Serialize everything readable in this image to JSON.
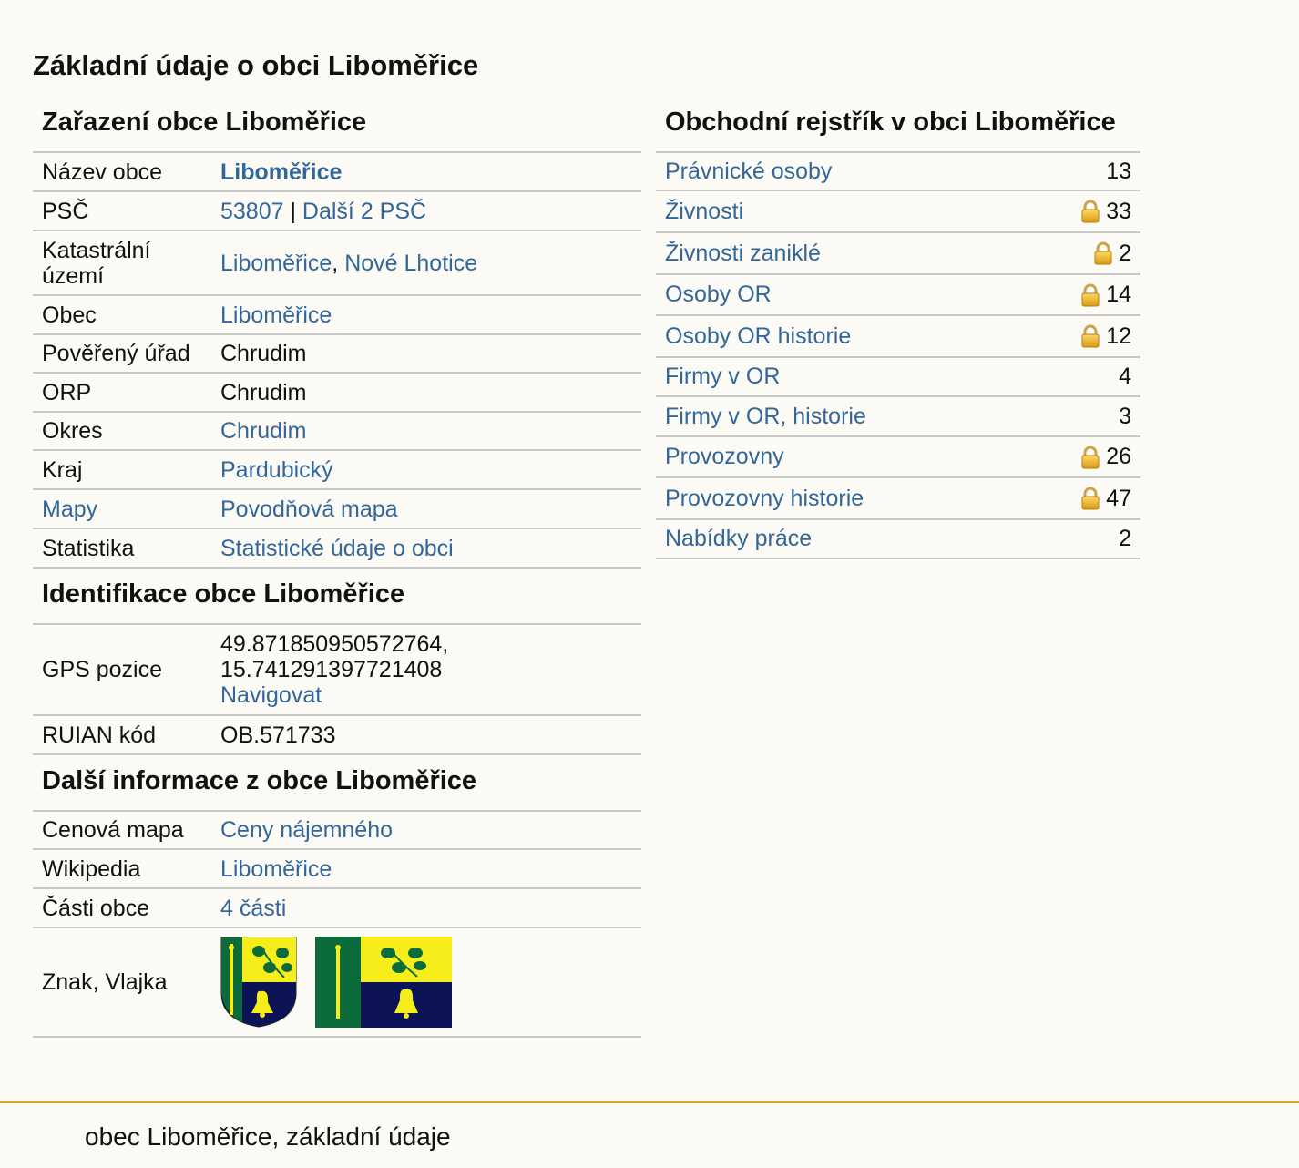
{
  "page_title": "Základní údaje o obci Liboměřice",
  "zarazeni": {
    "title": "Zařazení obce Liboměřice",
    "nazev_label": "Název obce",
    "nazev_value": "Liboměřice",
    "psc_label": "PSČ",
    "psc_value": "53807",
    "psc_sep": " | ",
    "psc_more": "Další 2 PSČ",
    "kat_label": "Katastrální území",
    "kat_value1": "Liboměřice",
    "kat_sep": ", ",
    "kat_value2": "Nové Lhotice",
    "obec_label": "Obec",
    "obec_value": "Liboměřice",
    "povereny_label": "Pověřený úřad",
    "povereny_value": "Chrudim",
    "orp_label": "ORP",
    "orp_value": "Chrudim",
    "okres_label": "Okres",
    "okres_value": "Chrudim",
    "kraj_label": "Kraj",
    "kraj_value": "Pardubický",
    "mapy_label": "Mapy",
    "mapy_value": "Povodňová mapa",
    "statistika_label": "Statistika",
    "statistika_value": "Statistické údaje o obci"
  },
  "identifikace": {
    "title": "Identifikace obce Liboměřice",
    "gps_label": "GPS pozice",
    "gps_lat": "49.871850950572764,",
    "gps_lon": "15.741291397721408",
    "gps_nav": "Navigovat",
    "ruian_label": "RUIAN kód",
    "ruian_value": "OB.571733"
  },
  "dalsi": {
    "title": "Další informace z obce Liboměřice",
    "cenova_label": "Cenová mapa",
    "cenova_value": "Ceny nájemného",
    "wiki_label": "Wikipedia",
    "wiki_value": "Liboměřice",
    "casti_label": "Části obce",
    "casti_value": "4 části",
    "znak_label": "Znak, Vlajka"
  },
  "rejstrik": {
    "title": "Obchodní rejstřík v obci Liboměřice",
    "items": [
      {
        "label": "Právnické osoby",
        "count": "13",
        "locked": false
      },
      {
        "label": "Živnosti",
        "count": "33",
        "locked": true
      },
      {
        "label": "Živnosti zaniklé",
        "count": "2",
        "locked": true
      },
      {
        "label": "Osoby OR",
        "count": "14",
        "locked": true
      },
      {
        "label": "Osoby OR historie",
        "count": "12",
        "locked": true
      },
      {
        "label": "Firmy v OR",
        "count": "4",
        "locked": false
      },
      {
        "label": "Firmy v OR, historie",
        "count": "3",
        "locked": false
      },
      {
        "label": "Provozovny",
        "count": "26",
        "locked": true
      },
      {
        "label": "Provozovny historie",
        "count": "47",
        "locked": true
      },
      {
        "label": "Nabídky práce",
        "count": "2",
        "locked": false
      }
    ]
  },
  "footer": {
    "text": "obec Liboměřice, základní údaje"
  },
  "colors": {
    "link": "#336699",
    "background": "#fbfaf5",
    "footer_line": "#d6a82e",
    "emblem_green": "#0b6b3a",
    "emblem_yellow": "#f5ee1a",
    "emblem_navy": "#0c1457"
  }
}
